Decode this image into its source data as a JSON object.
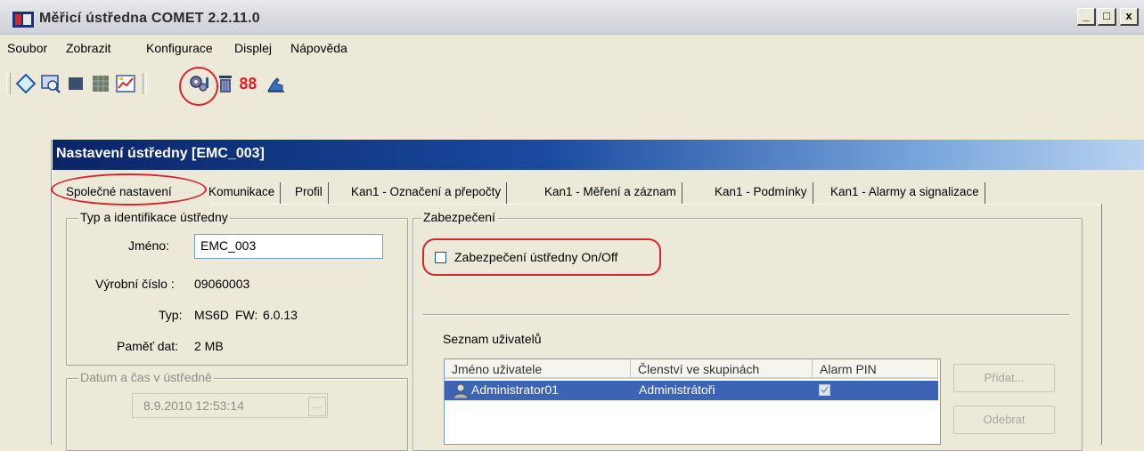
{
  "window": {
    "title": "Měřicí ústředna COMET  2.2.11.0",
    "controls": {
      "minimize": "_",
      "maximize": "□",
      "close": "x"
    }
  },
  "menu": [
    "Soubor",
    "Zobrazit",
    "Konfigurace",
    "Displej",
    "Nápověda"
  ],
  "toolbar": {
    "icons": [
      "connect-icon",
      "search-icon",
      "stop-icon",
      "grid-icon",
      "chart-icon",
      "settings-gear-icon",
      "trash-icon",
      "display-88-icon",
      "hand-icon"
    ],
    "display_label": "88"
  },
  "dialog": {
    "title": "Nastavení ústředny [EMC_003]",
    "tabs": [
      "Společné nastavení",
      "Komunikace",
      "Profil",
      "Kan1 - Označení a přepočty",
      "Kan1 - Měření a záznam",
      "Kan1 - Podmínky",
      "Kan1 - Alarmy a signalizace"
    ],
    "active_tab": "Společné nastavení",
    "identification": {
      "group_title": "Typ a identifikace ústředny",
      "name_label": "Jméno:",
      "name_value": "EMC_003",
      "serial_label": "Výrobní číslo :",
      "serial_value": "09060003",
      "type_label": "Typ:",
      "type_value": "MS6D",
      "fw_label": "FW:",
      "fw_value": "6.0.13",
      "memory_label": "Paměť dat:",
      "memory_value": "2 MB"
    },
    "datetime": {
      "group_title": "Datum a čas v ústředně",
      "value": "8.9.2010  12:53:14",
      "button": "..."
    },
    "security": {
      "group_title": "Zabezpečení",
      "checkbox_label": "Zabezpečení ústředny On/Off",
      "checked": false,
      "users_label": "Seznam uživatelů",
      "columns": [
        "Jméno uživatele",
        "Členství ve skupinách",
        "Alarm PIN"
      ],
      "rows": [
        {
          "name": "Administrator01",
          "groups": "Administrátoři",
          "alarm_pin": true
        }
      ],
      "add_button": "Přidat...",
      "remove_button": "Odebrat"
    }
  },
  "colors": {
    "window_bg": "#ece9d8",
    "dialog_title_start": "#0a2468",
    "dialog_title_end": "#b9d3f0",
    "selection": "#3d64b4",
    "highlight": "#d8252d"
  }
}
